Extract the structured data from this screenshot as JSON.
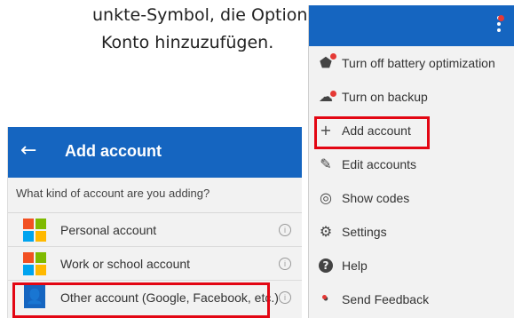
{
  "caption": {
    "line1": "unkte-Symbol, die Option",
    "line2": "Konto hinzuzufügen."
  },
  "left": {
    "back_icon": "back-arrow-icon",
    "title": "Add account",
    "question": "What kind of account are you adding?",
    "accounts": [
      {
        "label": "Personal account",
        "icon": "microsoft-logo-icon"
      },
      {
        "label": "Work or school account",
        "icon": "microsoft-logo-icon"
      },
      {
        "label": "Other account (Google, Facebook, etc.)",
        "icon": "person-icon"
      }
    ],
    "info_glyph": "i",
    "highlight_color": "#e30613",
    "header_color": "#1565c0"
  },
  "right": {
    "menu": [
      {
        "label": "Turn off battery optimization",
        "icon": "shield-alert-icon",
        "glyph": "⬟"
      },
      {
        "label": "Turn on backup",
        "icon": "cloud-icon",
        "glyph": "☁"
      },
      {
        "label": "Add account",
        "icon": "plus-icon",
        "glyph": "+"
      },
      {
        "label": "Edit accounts",
        "icon": "pencil-icon",
        "glyph": "✎"
      },
      {
        "label": "Show codes",
        "icon": "eye-icon",
        "glyph": "◎"
      },
      {
        "label": "Settings",
        "icon": "gear-icon",
        "glyph": "⚙"
      },
      {
        "label": "Help",
        "icon": "help-icon",
        "glyph": "?"
      },
      {
        "label": "Send Feedback",
        "icon": "feedback-icon",
        "glyph": "•"
      }
    ],
    "overflow_icon": "more-vertical-icon"
  }
}
